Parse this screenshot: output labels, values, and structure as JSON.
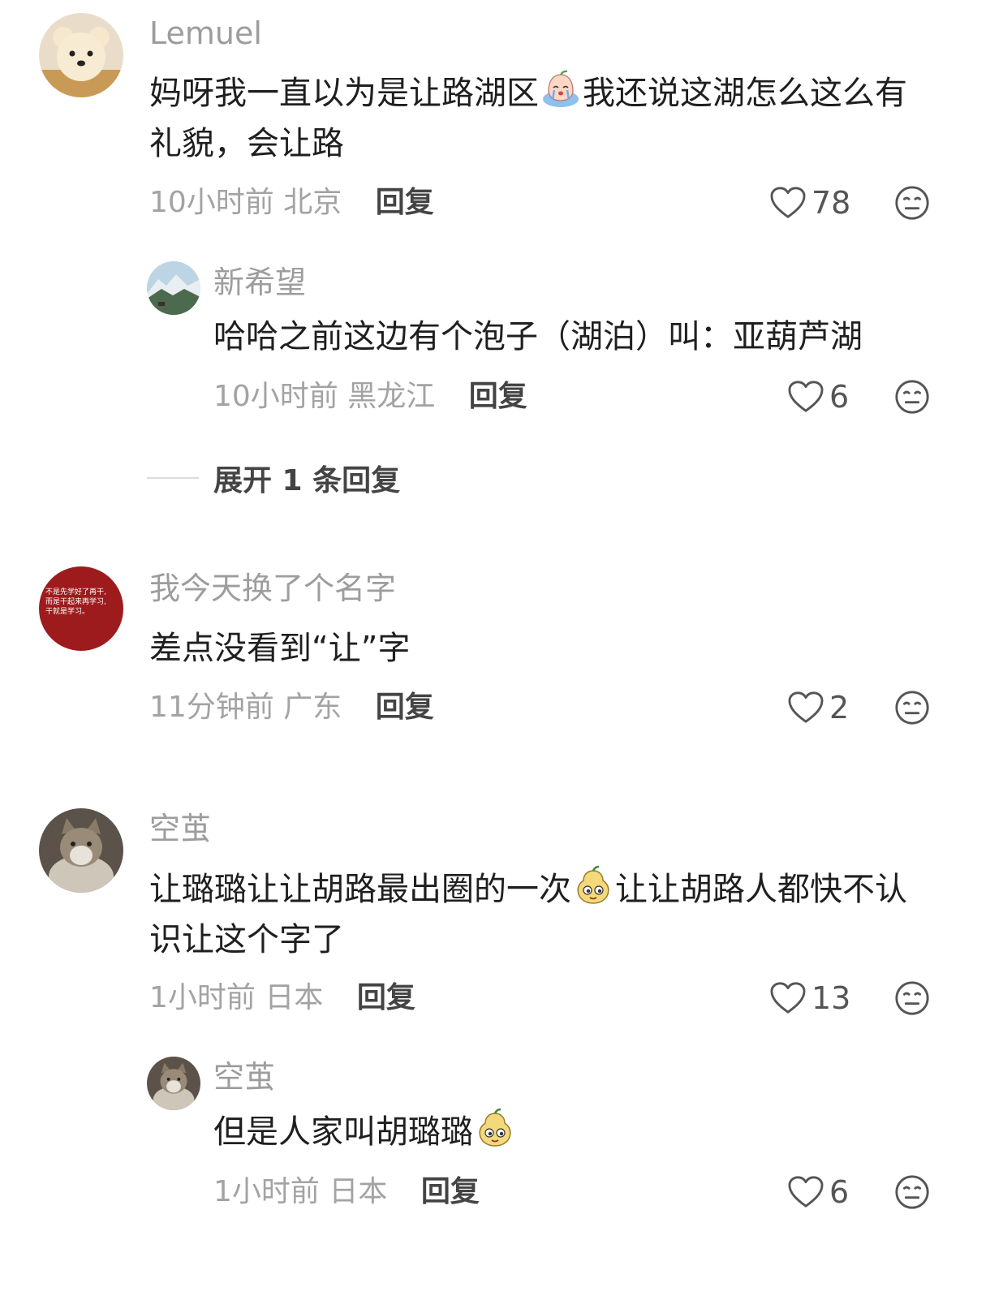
{
  "comments": [
    {
      "user": "Lemuel",
      "text_a": "妈呀我一直以为是让路湖区",
      "emoji_a": "crying-emoji",
      "text_b": "我还说这湖怎么这么有礼貌，会让路",
      "time": "10小时前",
      "location": "北京",
      "reply": "回复",
      "likes": "78"
    },
    {
      "user": "新希望",
      "text": "哈哈之前这边有个泡子（湖泊）叫：亚葫芦湖",
      "time": "10小时前",
      "location": "黑龙江",
      "reply": "回复",
      "likes": "6"
    },
    {
      "expand": "展开 1 条回复"
    },
    {
      "user": "我今天换了个名字",
      "avatar_text": [
        "不是先学好了再干,",
        "而是干起来再学习,",
        "干就是学习。"
      ],
      "text": "差点没看到“让”字",
      "time": "11分钟前",
      "location": "广东",
      "reply": "回复",
      "likes": "2"
    },
    {
      "user": "空茧",
      "text_a": "让璐璐让让胡路最出圈的一次",
      "emoji_a": "doge-gourd-emoji",
      "text_b": "让让胡路人都快不认识让这个字了",
      "time": "1小时前",
      "location": "日本",
      "reply": "回复",
      "likes": "13"
    },
    {
      "user": "空茧",
      "text_a": "但是人家叫胡璐璐",
      "emoji_a": "doge-gourd-emoji",
      "time": "1小时前",
      "location": "日本",
      "reply": "回复",
      "likes": "6"
    }
  ],
  "icons": {
    "like": "heart-outline-icon",
    "dislike": "meh-face-icon"
  }
}
